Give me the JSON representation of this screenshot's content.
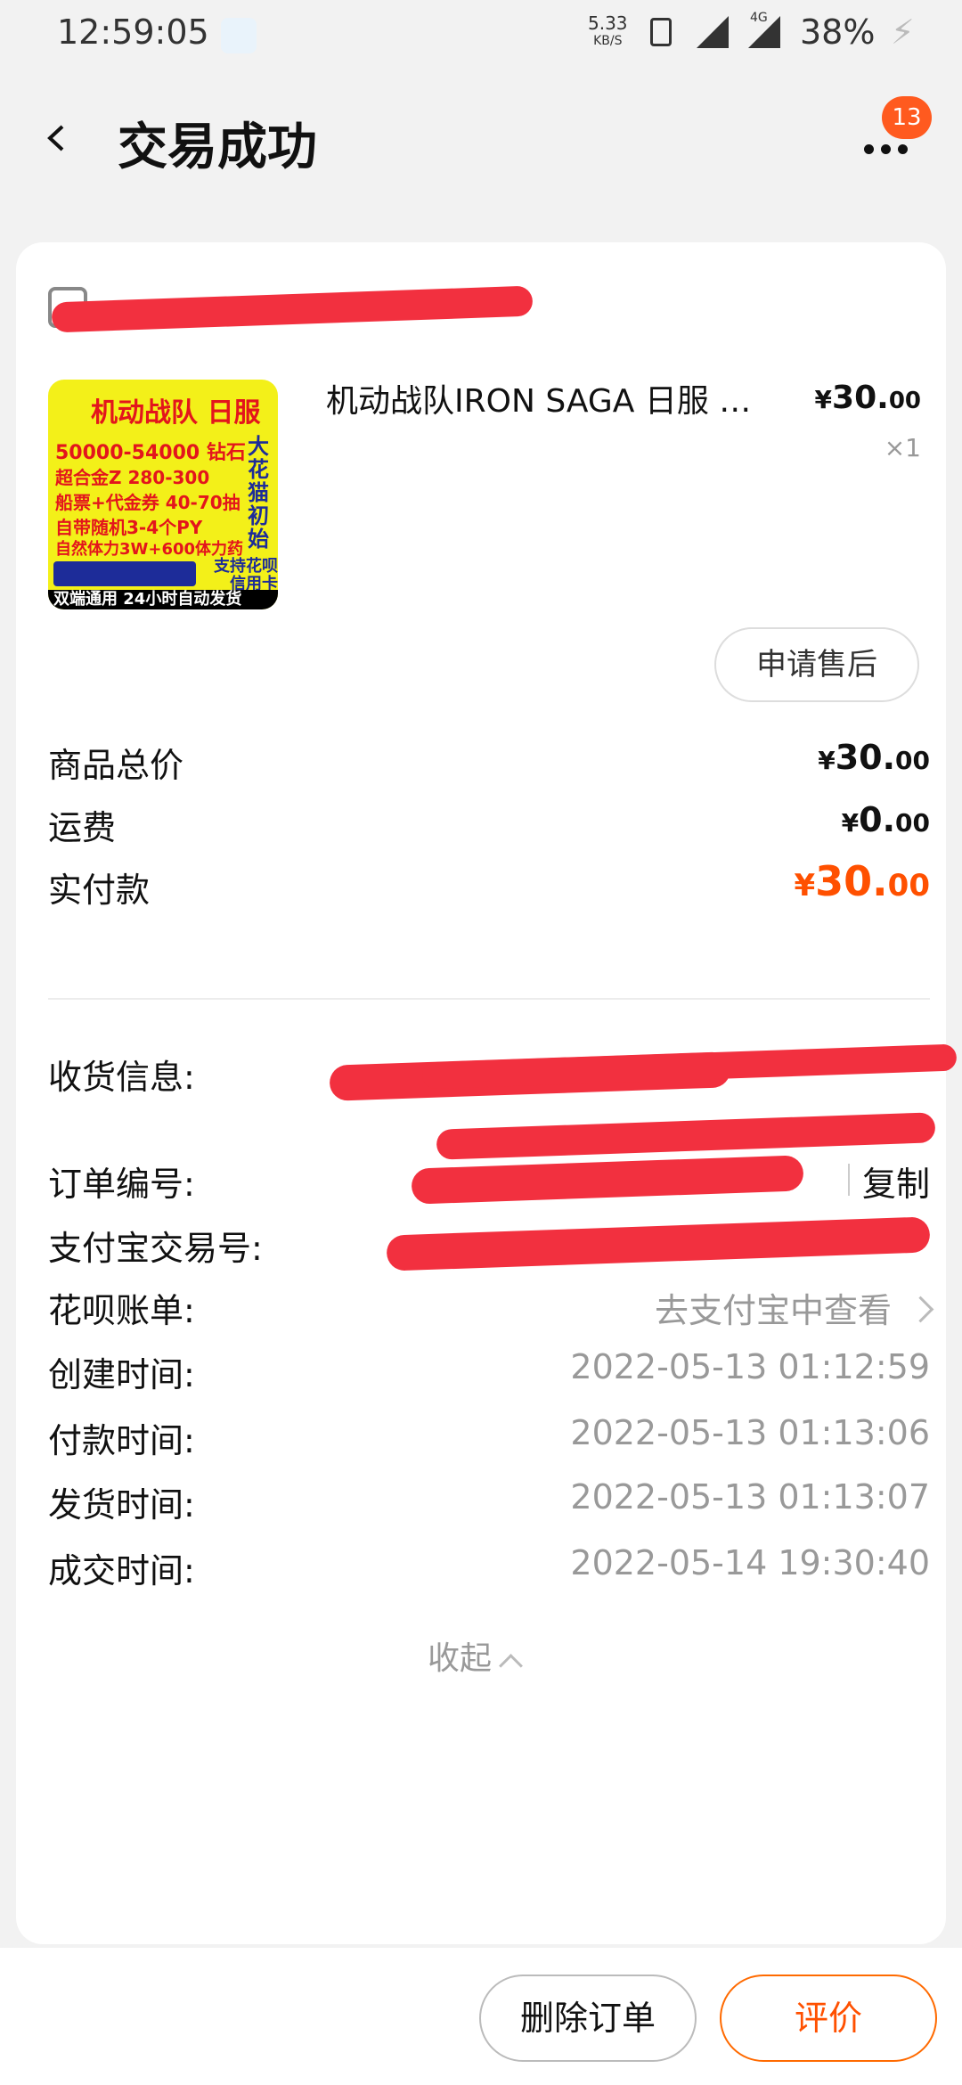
{
  "status_bar": {
    "time": "12:59:05",
    "net_speed": "5.33",
    "net_unit": "KB/S",
    "network_type": "4G",
    "battery": "38%"
  },
  "header": {
    "title": "交易成功",
    "badge_count": "13"
  },
  "product": {
    "thumb": {
      "line1": "机动战队 日服",
      "line2": "50000-54000 钻石",
      "line3": "超合金Z 280-300",
      "line4": "船票+代金券 40-70抽",
      "line5": "自带随机3-4个PY",
      "line6": "自然体力3W+600体力药",
      "side": "大花猫初始",
      "pay": "支持花呗信用卡",
      "footer": "双端通用 24小时自动发货"
    },
    "name": "机动战队IRON SAGA 日服 …",
    "price_yen": "¥",
    "price_int": "30.",
    "price_dec": "00",
    "quantity": "×1"
  },
  "aftersale_label": "申请售后",
  "summary": [
    {
      "label": "商品总价",
      "yen": "¥",
      "int": "30.",
      "dec": "00"
    },
    {
      "label": "运费",
      "yen": "¥",
      "int": "0.",
      "dec": "00"
    },
    {
      "label": "实付款",
      "yen": "¥",
      "int": "30.",
      "dec": "00"
    }
  ],
  "info": {
    "receiver_label": "收货信息:",
    "order_no_label": "订单编号:",
    "copy_label": "复制",
    "alipay_label": "支付宝交易号:",
    "huabei_label": "花呗账单:",
    "huabei_value": "去支付宝中查看",
    "created_label": "创建时间:",
    "created_value": "2022-05-13 01:12:59",
    "paid_label": "付款时间:",
    "paid_value": "2022-05-13 01:13:06",
    "shipped_label": "发货时间:",
    "shipped_value": "2022-05-13 01:13:07",
    "closed_label": "成交时间:",
    "closed_value": "2022-05-14 19:30:40"
  },
  "collapse_label": "收起",
  "bottom": {
    "delete_label": "删除订单",
    "rate_label": "评价"
  },
  "colors": {
    "accent": "#ff5000",
    "badge": "#ff5a1f",
    "redaction": "#f2303f"
  }
}
